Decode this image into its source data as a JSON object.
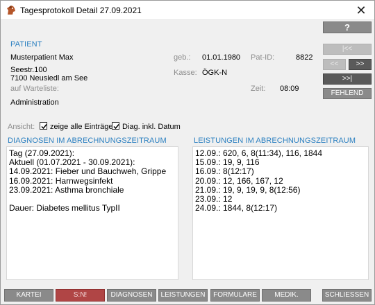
{
  "window": {
    "title": "Tagesprotokoll Detail 27.09.2021",
    "close_icon": "close-icon",
    "app_icon": "horse-head-icon"
  },
  "toolbar": {
    "help_label": "?"
  },
  "nav": {
    "first_label": "|<<",
    "prev_label": "<<",
    "next_label": ">>",
    "last_label": ">>|",
    "missing_label": "FEHLEND"
  },
  "patient": {
    "section_title": "PATIENT",
    "name": "Musterpatient Max",
    "street": "Seestr.100",
    "city": "7100 Neusiedl am See",
    "waitlist_label": "auf Warteliste:",
    "birth_label": "geb.:",
    "birth_value": "01.01.1980",
    "pid_label": "Pat-ID:",
    "pid_value": "8822",
    "kasse_label": "Kasse:",
    "kasse_value": "ÖGK-N",
    "time_label": "Zeit:",
    "time_value": "08:09",
    "administration": "Administration"
  },
  "view": {
    "label": "Ansicht:",
    "show_all_label": "zeige alle Einträge",
    "show_all_checked": true,
    "diag_date_label": "Diag. inkl. Datum",
    "diag_date_checked": true
  },
  "diagnoses": {
    "title": "DIAGNOSEN IM ABRECHNUNGSZEITRAUM",
    "lines": [
      "Tag (27.09.2021):",
      "Aktuell (01.07.2021 - 30.09.2021):",
      "14.09.2021: Fieber und Bauchweh, Grippe",
      "16.09.2021: Harnwegsinfekt",
      "23.09.2021: Asthma bronchiale",
      "",
      "Dauer: Diabetes mellitus TypII"
    ]
  },
  "services": {
    "title": "LEISTUNGEN IM ABRECHNUNGSZEITRAUM",
    "lines": [
      "12.09.: 620, 6, 8(11:34), 116, 1844",
      "15.09.: 19, 9, 116",
      "16.09.: 8(12:17)",
      "20.09.: 12, 166, 167, 12",
      "21.09.: 19, 9, 19, 9, 8(12:56)",
      "23.09.: 12",
      "24.09.: 1844, 8(12:17)"
    ]
  },
  "bottom": {
    "kartei": "KARTEI",
    "sn": "S:N!",
    "diagnosen": "DIAGNOSEN",
    "leistungen": "LEISTUNGEN",
    "formulare": "FORMULARE",
    "medik": "MEDIK.",
    "schliessen": "SCHLIESSEN"
  },
  "colors": {
    "accent_blue": "#2a7fc0",
    "button_grey": "#8a8a8a",
    "button_red": "#b04545"
  }
}
